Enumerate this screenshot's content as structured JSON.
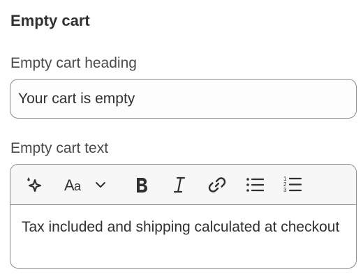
{
  "section": {
    "title": "Empty cart"
  },
  "heading_field": {
    "label": "Empty cart heading",
    "value": "Your cart is empty"
  },
  "text_field": {
    "label": "Empty cart text",
    "toolbar": [
      {
        "name": "magic-sparkle-icon",
        "action": "AI generate"
      },
      {
        "name": "font-style-icon",
        "action": "Text style"
      },
      {
        "name": "chevron-down-icon",
        "action": "Text style menu"
      },
      {
        "name": "bold-icon",
        "action": "Bold"
      },
      {
        "name": "italic-icon",
        "action": "Italic"
      },
      {
        "name": "link-icon",
        "action": "Link"
      },
      {
        "name": "bulleted-list-icon",
        "action": "Bulleted list"
      },
      {
        "name": "numbered-list-icon",
        "action": "Numbered list"
      }
    ],
    "value": "Tax included and shipping calculated at checkout"
  }
}
